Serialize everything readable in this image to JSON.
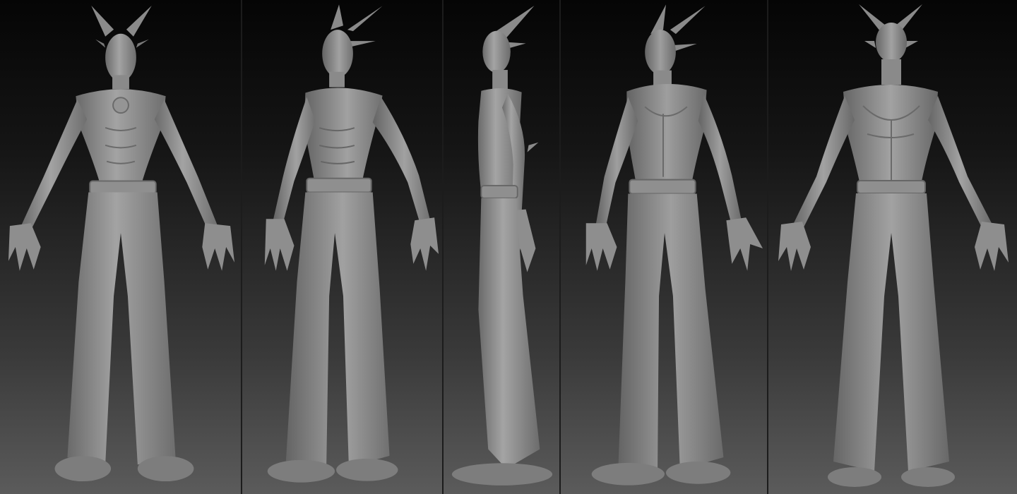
{
  "sheet": {
    "kind": "character turnaround",
    "views": [
      {
        "id": "front",
        "icon": "front-view-figure"
      },
      {
        "id": "three-quarter-front",
        "icon": "three-quarter-front-view-figure"
      },
      {
        "id": "side",
        "icon": "side-view-figure"
      },
      {
        "id": "three-quarter-back",
        "icon": "three-quarter-back-view-figure"
      },
      {
        "id": "back",
        "icon": "back-view-figure"
      }
    ]
  },
  "colors": {
    "background_top": "#050505",
    "background_bottom": "#5b5b5b",
    "clay_light": "#a7a7a7",
    "clay_mid": "#858585",
    "clay_dark": "#5e5e5e",
    "divider": "#1c1c1c"
  }
}
